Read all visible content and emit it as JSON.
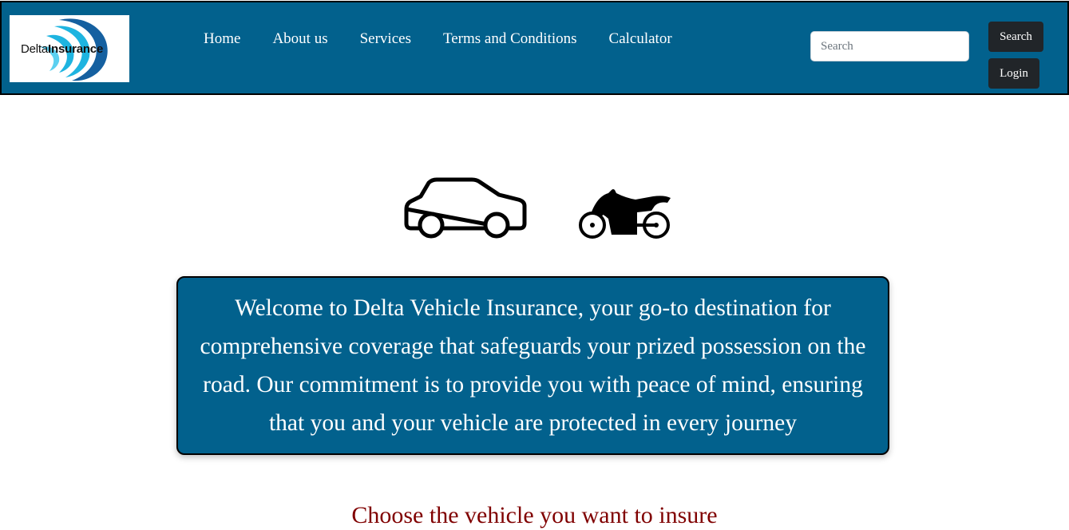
{
  "logo": {
    "text_plain": "Delta",
    "text_bold": "Insurance"
  },
  "nav": {
    "links": [
      {
        "label": "Home"
      },
      {
        "label": "About us"
      },
      {
        "label": "Services"
      },
      {
        "label": "Terms and Conditions"
      },
      {
        "label": "Calculator"
      }
    ]
  },
  "search": {
    "placeholder": "Search",
    "value": "",
    "button_label": "Search"
  },
  "login": {
    "button_label": "Login"
  },
  "vehicles": {
    "icons": [
      "car-icon",
      "motorcycle-icon"
    ]
  },
  "welcome": {
    "text": "Welcome to Delta Vehicle Insurance, your go-to destination for comprehensive coverage that safeguards your prized possession on the road. Our commitment is to provide you with peace of mind, ensuring that you and your vehicle are protected in every journey"
  },
  "section": {
    "heading": "Choose the vehicle you want to insure"
  },
  "colors": {
    "brand_blue": "#02618d",
    "button_dark": "#212529",
    "heading_maroon": "#800000",
    "logo_cyan": "#1eb4e0"
  }
}
